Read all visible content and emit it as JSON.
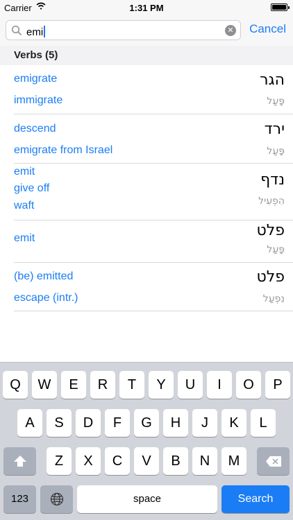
{
  "status_bar": {
    "carrier": "Carrier",
    "time": "1:31 PM"
  },
  "search": {
    "query": "emi",
    "cancel_label": "Cancel"
  },
  "section": {
    "title": "Verbs (5)"
  },
  "entries": [
    {
      "translations": [
        "emigrate",
        "immigrate"
      ],
      "hebrew": "הגר",
      "binyan": "פָּעַל"
    },
    {
      "translations": [
        "descend",
        "emigrate from Israel"
      ],
      "hebrew": "ירד",
      "binyan": "פָּעַל"
    },
    {
      "translations": [
        "emit",
        "give off",
        "waft"
      ],
      "hebrew": "נדף",
      "binyan": "הִפְעִיל"
    },
    {
      "translations": [
        "emit"
      ],
      "hebrew": "פלט",
      "binyan": "פָּעַל"
    },
    {
      "translations": [
        "(be) emitted",
        "escape (intr.)"
      ],
      "hebrew": "פלט",
      "binyan": "נִפְעַל"
    }
  ],
  "keyboard": {
    "row1": [
      "Q",
      "W",
      "E",
      "R",
      "T",
      "Y",
      "U",
      "I",
      "O",
      "P"
    ],
    "row2": [
      "A",
      "S",
      "D",
      "F",
      "G",
      "H",
      "J",
      "K",
      "L"
    ],
    "row3": [
      "Z",
      "X",
      "C",
      "V",
      "B",
      "N",
      "M"
    ],
    "numbers_label": "123",
    "space_label": "space",
    "search_label": "Search"
  },
  "colors": {
    "accent": "#1a7df5",
    "keyboard_bg": "#d1d4da",
    "section_bg": "#f2f2f4"
  }
}
